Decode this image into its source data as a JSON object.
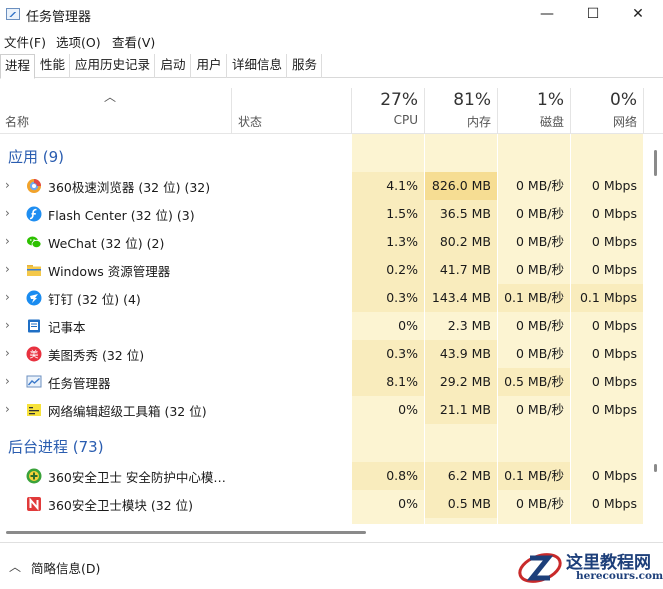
{
  "window": {
    "title": "任务管理器",
    "minimize": "—",
    "maximize": "☐",
    "close": "✕"
  },
  "menu": [
    "文件(F)",
    "选项(O)",
    "查看(V)"
  ],
  "tabs": [
    "进程",
    "性能",
    "应用历史记录",
    "启动",
    "用户",
    "详细信息",
    "服务"
  ],
  "active_tab": "进程",
  "header": {
    "name": "名称",
    "status": "状态",
    "cpu": {
      "pct": "27%",
      "label": "CPU"
    },
    "mem": {
      "pct": "81%",
      "label": "内存"
    },
    "disk": {
      "pct": "1%",
      "label": "磁盘"
    },
    "net": {
      "pct": "0%",
      "label": "网络"
    }
  },
  "groups": {
    "apps": "应用 (9)",
    "background": "后台进程 (73)"
  },
  "apps": [
    {
      "name": "360极速浏览器 (32 位) (32)",
      "cpu": "4.1%",
      "mem": "826.0 MB",
      "disk": "0 MB/秒",
      "net": "0 Mbps",
      "icon": "360-browser-icon"
    },
    {
      "name": "Flash Center (32 位) (3)",
      "cpu": "1.5%",
      "mem": "36.5 MB",
      "disk": "0 MB/秒",
      "net": "0 Mbps",
      "icon": "flash-icon"
    },
    {
      "name": "WeChat (32 位) (2)",
      "cpu": "1.3%",
      "mem": "80.2 MB",
      "disk": "0 MB/秒",
      "net": "0 Mbps",
      "icon": "wechat-icon"
    },
    {
      "name": "Windows 资源管理器",
      "cpu": "0.2%",
      "mem": "41.7 MB",
      "disk": "0 MB/秒",
      "net": "0 Mbps",
      "icon": "folder-icon"
    },
    {
      "name": "钉钉 (32 位) (4)",
      "cpu": "0.3%",
      "mem": "143.4 MB",
      "disk": "0.1 MB/秒",
      "net": "0.1 Mbps",
      "icon": "dingtalk-icon"
    },
    {
      "name": "记事本",
      "cpu": "0%",
      "mem": "2.3 MB",
      "disk": "0 MB/秒",
      "net": "0 Mbps",
      "icon": "notepad-icon"
    },
    {
      "name": "美图秀秀 (32 位)",
      "cpu": "0.3%",
      "mem": "43.9 MB",
      "disk": "0 MB/秒",
      "net": "0 Mbps",
      "icon": "meitu-icon"
    },
    {
      "name": "任务管理器",
      "cpu": "8.1%",
      "mem": "29.2 MB",
      "disk": "0.5 MB/秒",
      "net": "0 Mbps",
      "icon": "task-manager-icon"
    },
    {
      "name": "网络编辑超级工具箱 (32 位)",
      "cpu": "0%",
      "mem": "21.1 MB",
      "disk": "0 MB/秒",
      "net": "0 Mbps",
      "icon": "toolbox-icon"
    }
  ],
  "background": [
    {
      "name": "360安全卫士 安全防护中心模块...",
      "cpu": "0.8%",
      "mem": "6.2 MB",
      "disk": "0.1 MB/秒",
      "net": "0 Mbps",
      "icon": "360-shield-icon"
    },
    {
      "name": "360安全卫士模块 (32 位)",
      "cpu": "0%",
      "mem": "0.5 MB",
      "disk": "0 MB/秒",
      "net": "0 Mbps",
      "icon": "360-module-icon"
    }
  ],
  "footer": {
    "label": "简略信息(D)"
  },
  "watermark": {
    "title": "这里教程网",
    "url": "herecours.com"
  },
  "colors": {
    "light": "#fcf4d2",
    "medium": "#f9ecbd",
    "strong": "#f6dd93",
    "accent": "#2a5db0"
  }
}
